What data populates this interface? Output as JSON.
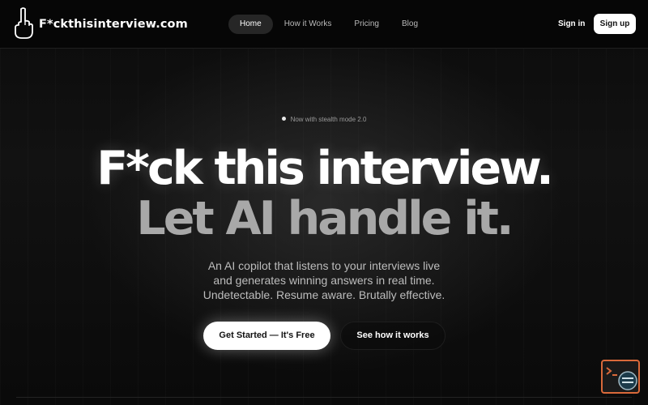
{
  "header": {
    "logo_text": "F*ckthisinterview.com",
    "nav": [
      {
        "label": "Home",
        "active": true
      },
      {
        "label": "How it Works",
        "active": false
      },
      {
        "label": "Pricing",
        "active": false
      },
      {
        "label": "Blog",
        "active": false
      }
    ],
    "signin_label": "Sign in",
    "signup_label": "Sign up"
  },
  "hero": {
    "badge": "Now with stealth mode 2.0",
    "headline_line1": "F*ck this interview.",
    "headline_line2": "Let AI handle it.",
    "description_lines": [
      "An AI copilot that listens to your interviews live",
      "and generates winning answers in real time.",
      "Undetectable. Resume aware. Brutally effective."
    ],
    "cta_primary": "Get Started — It's Free",
    "cta_secondary": "See how it works"
  },
  "widget": {
    "icon": "chat-support-icon",
    "accent": "#d9693a"
  },
  "colors": {
    "background": "#0b0b0b",
    "text": "#ffffff",
    "muted_headline": "#a8a8a8",
    "button_bg": "#ffffff"
  }
}
